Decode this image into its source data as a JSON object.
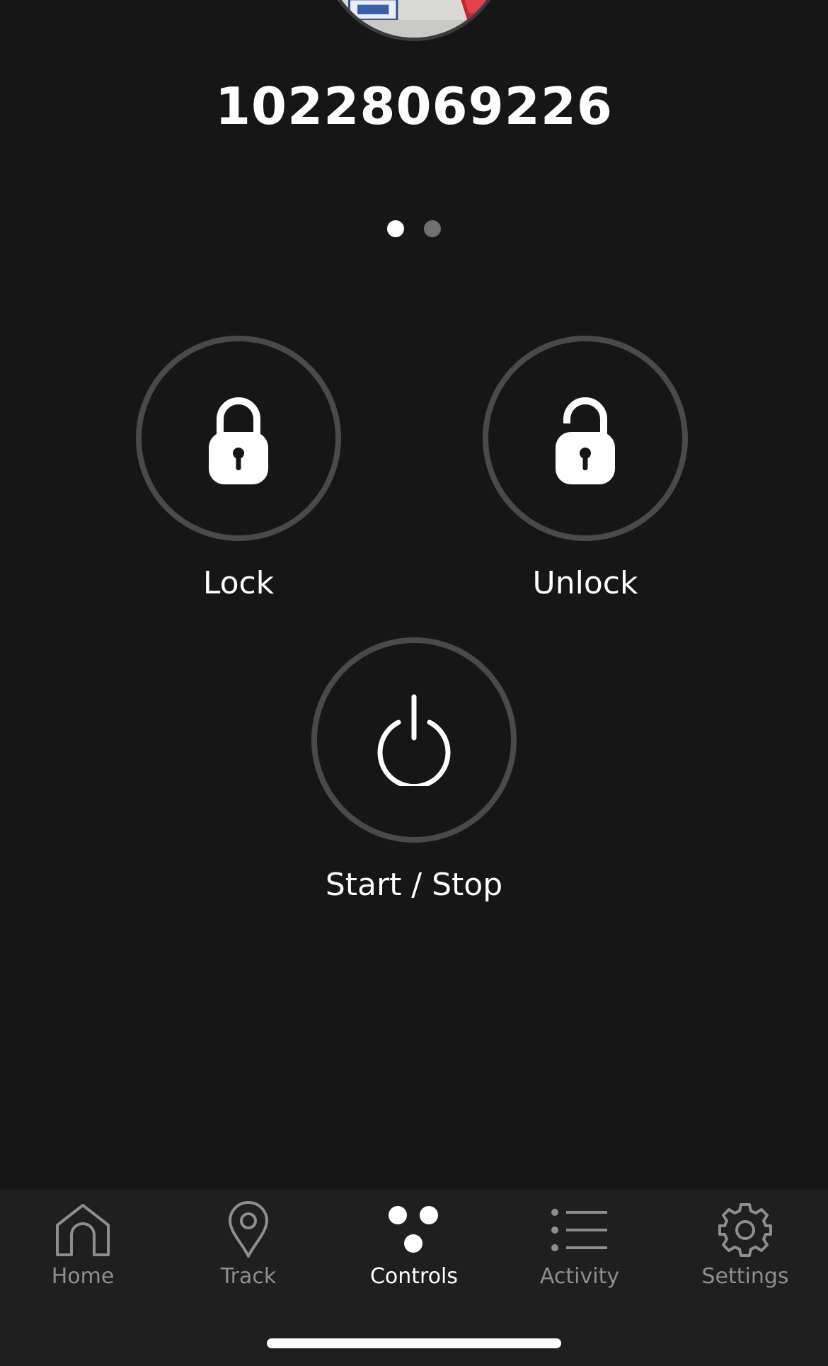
{
  "vehicle": {
    "id": "10228069226"
  },
  "pager": {
    "pages": 2,
    "active_index": 0
  },
  "controls": {
    "lock_label": "Lock",
    "unlock_label": "Unlock",
    "start_stop_label": "Start / Stop"
  },
  "tabbar": {
    "items": [
      {
        "label": "Home",
        "icon": "home-icon",
        "active": false
      },
      {
        "label": "Track",
        "icon": "location-pin-icon",
        "active": false
      },
      {
        "label": "Controls",
        "icon": "controls-dots-icon",
        "active": true
      },
      {
        "label": "Activity",
        "icon": "list-icon",
        "active": false
      },
      {
        "label": "Settings",
        "icon": "gear-icon",
        "active": false
      }
    ]
  },
  "colors": {
    "background": "#161617",
    "ring": "#4a4a4c",
    "tabbar_background": "#1f1f20",
    "tab_inactive": "#8e8e90",
    "tab_active": "#ffffff"
  }
}
